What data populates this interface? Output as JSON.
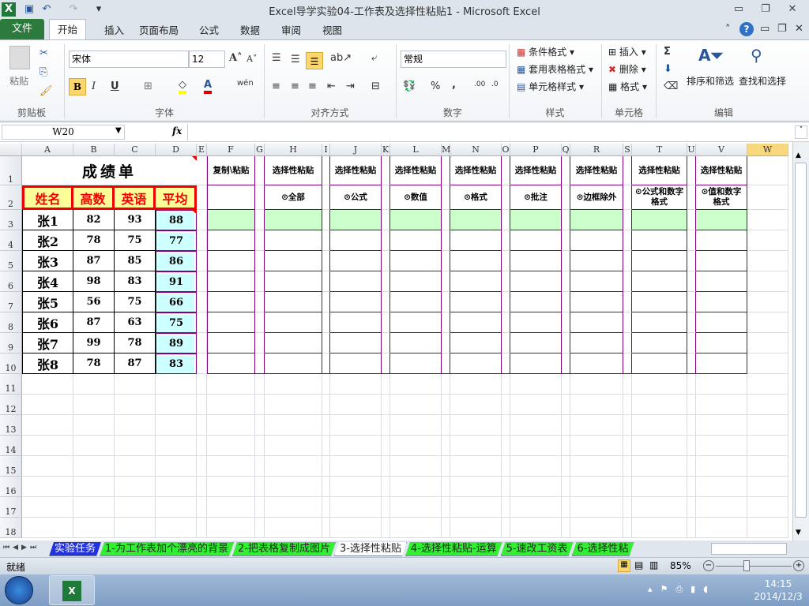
{
  "window": {
    "title": "Excel导学实验04-工作表及选择性粘贴1  -  Microsoft Excel"
  },
  "tabs": [
    "文件",
    "开始",
    "插入",
    "页面布局",
    "公式",
    "数据",
    "审阅",
    "视图"
  ],
  "ribbon": {
    "clipboard": {
      "paste": "粘贴",
      "label": "剪贴板"
    },
    "font": {
      "name": "宋体",
      "size": "12",
      "label": "字体",
      "bold": "B",
      "italic": "I",
      "underline": "U",
      "phonetic": "wén"
    },
    "align": {
      "label": "对齐方式"
    },
    "number": {
      "format": "常规",
      "label": "数字",
      "percent": "%",
      "comma": ","
    },
    "styles": {
      "conditional": "条件格式",
      "table": "套用表格格式",
      "cell": "单元格样式",
      "label": "样式"
    },
    "cells": {
      "insert": "插入",
      "delete": "删除",
      "format": "格式",
      "label": "单元格"
    },
    "editing": {
      "sort": "排序和筛选",
      "find": "查找和选择",
      "label": "编辑",
      "sum": "Σ"
    }
  },
  "formula_bar": {
    "name_box": "W20",
    "fx": "fx",
    "value": ""
  },
  "columns": [
    "A",
    "B",
    "C",
    "D",
    "E",
    "F",
    "G",
    "H",
    "I",
    "J",
    "K",
    "L",
    "M",
    "N",
    "O",
    "P",
    "Q",
    "R",
    "S",
    "T",
    "U",
    "V",
    "W"
  ],
  "rows": [
    "1",
    "2",
    "3",
    "4",
    "5",
    "6",
    "7",
    "8",
    "9",
    "10",
    "11",
    "12",
    "13",
    "14",
    "15",
    "16",
    "17",
    "18"
  ],
  "score_table": {
    "title": "成绩单",
    "headers": [
      "姓名",
      "高数",
      "英语",
      "平均"
    ],
    "rows": [
      [
        "张1",
        "82",
        "93",
        "88"
      ],
      [
        "张2",
        "78",
        "75",
        "77"
      ],
      [
        "张3",
        "87",
        "85",
        "86"
      ],
      [
        "张4",
        "98",
        "83",
        "91"
      ],
      [
        "张5",
        "56",
        "75",
        "66"
      ],
      [
        "张6",
        "87",
        "63",
        "75"
      ],
      [
        "张7",
        "99",
        "78",
        "89"
      ],
      [
        "张8",
        "78",
        "87",
        "83"
      ]
    ]
  },
  "paste_table": {
    "headers": [
      "复制\\粘贴",
      "选择性粘贴",
      "选择性粘贴",
      "选择性粘贴",
      "选择性粘贴",
      "选择性粘贴",
      "选择性粘贴",
      "选择性粘贴",
      "选择性粘贴"
    ],
    "options": [
      "",
      "⊙全部",
      "⊙公式",
      "⊙数值",
      "⊙格式",
      "⊙批注",
      "⊙边框除外",
      "⊙公式和数字格式",
      "⊙值和数字格式"
    ]
  },
  "sheets": [
    "实验任务",
    "1-为工作表加个漂亮的背景",
    "2-把表格复制成图片",
    "3-选择性粘贴",
    "4-选择性粘贴-运算",
    "5-速改工资表",
    "6-选择性粘"
  ],
  "status": {
    "ready": "就绪",
    "zoom": "85%"
  },
  "taskbar": {
    "time": "14:15",
    "date": "2014/12/3"
  }
}
